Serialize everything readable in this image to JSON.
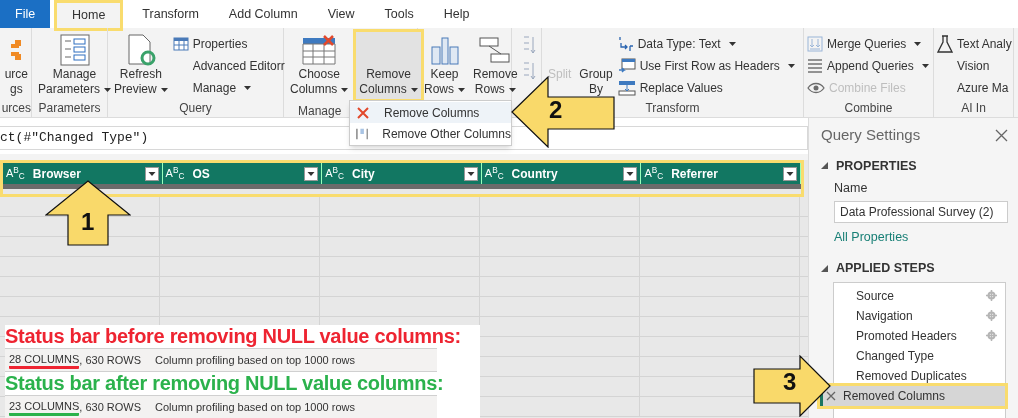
{
  "ribbon_tabs": [
    {
      "label": "File",
      "kind": "file",
      "selected": false
    },
    {
      "label": "Home",
      "kind": "tab",
      "selected": true
    },
    {
      "label": "Transform",
      "kind": "tab",
      "selected": false
    },
    {
      "label": "Add Column",
      "kind": "tab",
      "selected": false
    },
    {
      "label": "View",
      "kind": "tab",
      "selected": false
    },
    {
      "label": "Tools",
      "kind": "tab",
      "selected": false
    },
    {
      "label": "Help",
      "kind": "tab",
      "selected": false
    }
  ],
  "ribbon_groups": [
    {
      "label": "urces",
      "items": [
        {
          "kind": "large",
          "lines": [
            "urce",
            "gs"
          ],
          "dropdown": false,
          "disabled": false,
          "highlighted": false
        }
      ]
    },
    {
      "label": "Parameters",
      "items": [
        {
          "kind": "large",
          "lines": [
            "Manage",
            "Parameters"
          ],
          "dropdown": true,
          "disabled": false,
          "highlighted": false
        }
      ]
    },
    {
      "label": "Query",
      "items": [
        {
          "kind": "large",
          "lines": [
            "Refresh",
            "Preview"
          ],
          "dropdown": true,
          "disabled": false,
          "highlighted": false
        },
        {
          "kind": "small",
          "lines": [
            "Properties"
          ],
          "dropdown": false,
          "disabled": false,
          "highlighted": false
        },
        {
          "kind": "small",
          "lines": [
            "Advanced Editorr"
          ],
          "dropdown": false,
          "disabled": false,
          "highlighted": false
        },
        {
          "kind": "small",
          "lines": [
            "Manage"
          ],
          "dropdown": true,
          "disabled": false,
          "highlighted": false
        }
      ]
    },
    {
      "label": "Manage",
      "items": [
        {
          "kind": "large",
          "lines": [
            "Choose",
            "Columns"
          ],
          "dropdown": true,
          "disabled": false,
          "highlighted": false
        },
        {
          "kind": "large",
          "lines": [
            "Remove",
            "Columns"
          ],
          "dropdown": true,
          "disabled": false,
          "highlighted": true
        }
      ]
    },
    {
      "items": [
        {
          "kind": "large",
          "lines": [
            "Keep",
            "Rows"
          ],
          "dropdown": true,
          "disabled": false,
          "highlighted": false
        },
        {
          "kind": "large",
          "lines": [
            "Remove",
            "Rows"
          ],
          "dropdown": true,
          "disabled": false,
          "highlighted": false
        }
      ]
    },
    {
      "kind": "sort"
    },
    {
      "label": "Transform",
      "items": [
        {
          "kind": "large",
          "lines": [
            "Split"
          ],
          "dropdown": false,
          "disabled": true,
          "highlighted": false
        },
        {
          "kind": "large",
          "lines": [
            "Group",
            "By"
          ],
          "dropdown": false,
          "disabled": false,
          "highlighted": false
        },
        {
          "kind": "small",
          "lines": [
            "Data Type: Text"
          ],
          "dropdown": true,
          "disabled": false,
          "highlighted": false
        },
        {
          "kind": "small",
          "lines": [
            "Use First Row as Headers"
          ],
          "dropdown": true,
          "disabled": false,
          "highlighted": false
        },
        {
          "kind": "small",
          "lines": [
            "Replace Values"
          ],
          "dropdown": false,
          "disabled": false,
          "highlighted": false
        }
      ]
    },
    {
      "label": "Combine",
      "items": [
        {
          "kind": "small",
          "lines": [
            "Merge Queries"
          ],
          "dropdown": true,
          "disabled": false,
          "highlighted": false
        },
        {
          "kind": "small",
          "lines": [
            "Append Queries"
          ],
          "dropdown": true,
          "disabled": false,
          "highlighted": false
        },
        {
          "kind": "small",
          "lines": [
            "Combine Files"
          ],
          "dropdown": false,
          "disabled": true,
          "highlighted": false
        }
      ]
    },
    {
      "label": "AI In",
      "items": [
        {
          "kind": "small",
          "lines": [
            "Text Analy"
          ],
          "dropdown": false,
          "disabled": false,
          "highlighted": false
        },
        {
          "kind": "small",
          "lines": [
            "Vision"
          ],
          "dropdown": false,
          "disabled": false,
          "highlighted": false
        },
        {
          "kind": "small",
          "lines": [
            "Azure Ma"
          ],
          "dropdown": false,
          "disabled": false,
          "highlighted": false
        }
      ]
    }
  ],
  "dropdown_menu": [
    {
      "label": "Remove Columns",
      "hovered": true
    },
    {
      "label": "Remove Other Columns",
      "hovered": false
    }
  ],
  "formula": "ct(#\"Changed Type\")",
  "table": {
    "columns": [
      {
        "type": "A$^{B}$$_{C}$",
        "name": "Browser"
      },
      {
        "type": "A$^{B}$$_{C}$",
        "name": "OS"
      },
      {
        "type": "A$^{B}$$_{C}$",
        "name": "City"
      },
      {
        "type": "A$^{B}$$_{C}$",
        "name": "Country"
      },
      {
        "type": "A$^{B}$$_{C}$",
        "name": "Referrer"
      }
    ]
  },
  "callouts": [
    {
      "number": "1"
    },
    {
      "number": "2"
    },
    {
      "number": "3"
    }
  ],
  "status_notes": [
    {
      "heading": "Status bar before removing NULL value columns:",
      "color": "#ee2431",
      "columns": "28 COLUMNS",
      "rest": ", 630 ROWS",
      "profiling": "Column profiling based on top 1000 rows"
    },
    {
      "heading": "Status bar after removing NULL value columns:",
      "color": "#2bb24c",
      "columns": "23 COLUMNS",
      "rest": ", 630 ROWS",
      "profiling": "Column profiling based on top 1000 rows"
    }
  ],
  "query_settings": {
    "title": "Query Settings",
    "properties_heading": "PROPERTIES",
    "name_label": "Name",
    "name_value": "Data Professional Survey (2)",
    "all_properties": "All Properties",
    "steps_heading": "APPLIED STEPS",
    "steps": [
      {
        "label": "Source",
        "has_settings": true,
        "selected": false
      },
      {
        "label": "Navigation",
        "has_settings": true,
        "selected": false
      },
      {
        "label": "Promoted Headers",
        "has_settings": true,
        "selected": false
      },
      {
        "label": "Changed Type",
        "has_settings": false,
        "selected": false
      },
      {
        "label": "Removed Duplicates",
        "has_settings": false,
        "selected": false
      },
      {
        "label": "Removed Columns",
        "has_settings": false,
        "selected": true
      }
    ]
  }
}
